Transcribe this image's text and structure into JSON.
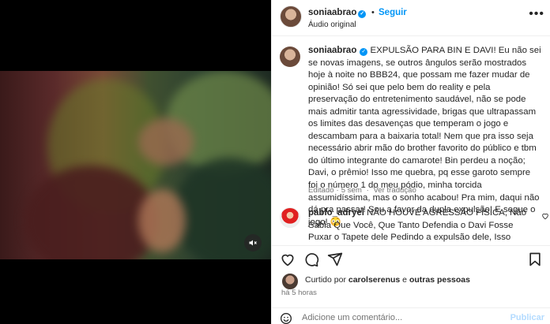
{
  "post": {
    "username": "soniaabrao",
    "follow_label": "Seguir",
    "dot": "•",
    "audio": "Áudio original",
    "more": "•••"
  },
  "caption": {
    "username": "soniaabrao",
    "text": "EXPULSÃO PARA BIN E DAVI! Eu não sei se novas imagens, se outros ângulos serão mostrados hoje à noite no BBB24, que possam me fazer mudar de opinião! Só sei que pelo bem do reality e pela preservação do entretenimento saudável, não se pode mais admitir tanta agressividade, brigas que ultrapassam os limites das desavenças que temperam o jogo e descambam para a baixaria total! Nem que pra isso seja necessário abrir mão do brother favorito do público e tbm do último integrante do camarote! Bin perdeu a noção; Davi, o prêmio! Isso me quebra, pq esse garoto sempre foi o número 1 do meu pódio, minha torcida assumidíssima, mas o sonho acabou! Pra mim, daqui não dá pra passar! Sou a favor da dupla expulsão! E segue o jogo! 😳",
    "edited": "Editado",
    "separator": "·",
    "ago": "5 sem",
    "translation": "Ver tradução"
  },
  "comment": {
    "username": "pablo_adryel",
    "text": "NÃO HOUVE AGRESSÃO FÍSICA, Não Sabia Que Você, Que Tanto Defendia o Davi Fosse Puxar o Tapete dele Pedindo a expulsão dele, Isso Mostra Que Você Tava Torcendo Só por Interesse do Povo De Bo Se Sembem... Que pode parar"
  },
  "likes": {
    "prefix": "Curtido por",
    "user": "carolserenus",
    "connector": "e",
    "others": "outras pessoas"
  },
  "time": "há 5 horas",
  "add_comment": {
    "placeholder": "Adicione um comentário...",
    "publish": "Publicar"
  },
  "colors": {
    "accent": "#0095f6",
    "text": "#262626",
    "muted": "#737373",
    "border": "#efefef"
  },
  "icons": [
    "verified-icon",
    "more-icon",
    "mute-icon",
    "heart-icon",
    "comment-icon",
    "share-icon",
    "bookmark-icon",
    "emoji-icon"
  ]
}
